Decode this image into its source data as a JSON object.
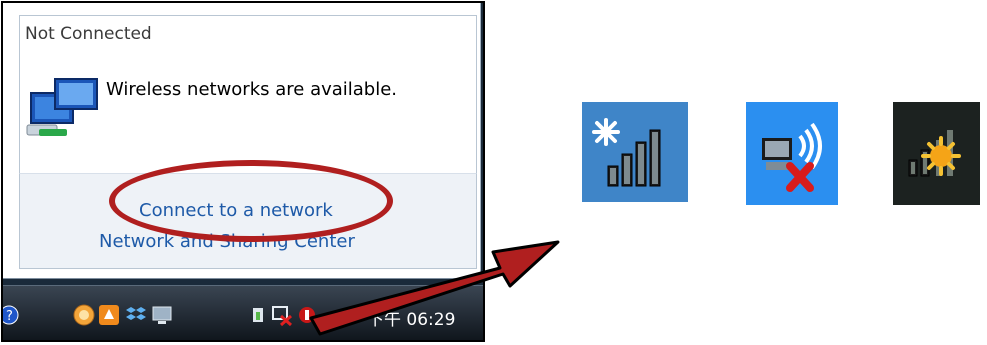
{
  "flyout": {
    "status_title": "Not Connected",
    "message": "Wireless networks are available.",
    "links": {
      "connect": "Connect to a network",
      "sharing_center": "Network and Sharing Center"
    },
    "highlight_color": "#b01f1f"
  },
  "taskbar": {
    "clock": "下午 06:29",
    "tray_icons": [
      "help-icon",
      "instant-messenger-icon",
      "orange-app-icon",
      "dropbox-icon",
      "display-icon",
      "power-plug-icon",
      "network-disconnected-icon",
      "security-shield-icon"
    ]
  },
  "status_tiles": [
    {
      "name": "wireless-signal-icon",
      "state": "available",
      "background": "#3f85c8"
    },
    {
      "name": "network-disconnected-icon",
      "state": "disconnected",
      "background": "#2b8ff0"
    },
    {
      "name": "searching-signal-icon",
      "state": "searching",
      "background": "#1c2220"
    }
  ],
  "arrow_color": "#b01f1f"
}
